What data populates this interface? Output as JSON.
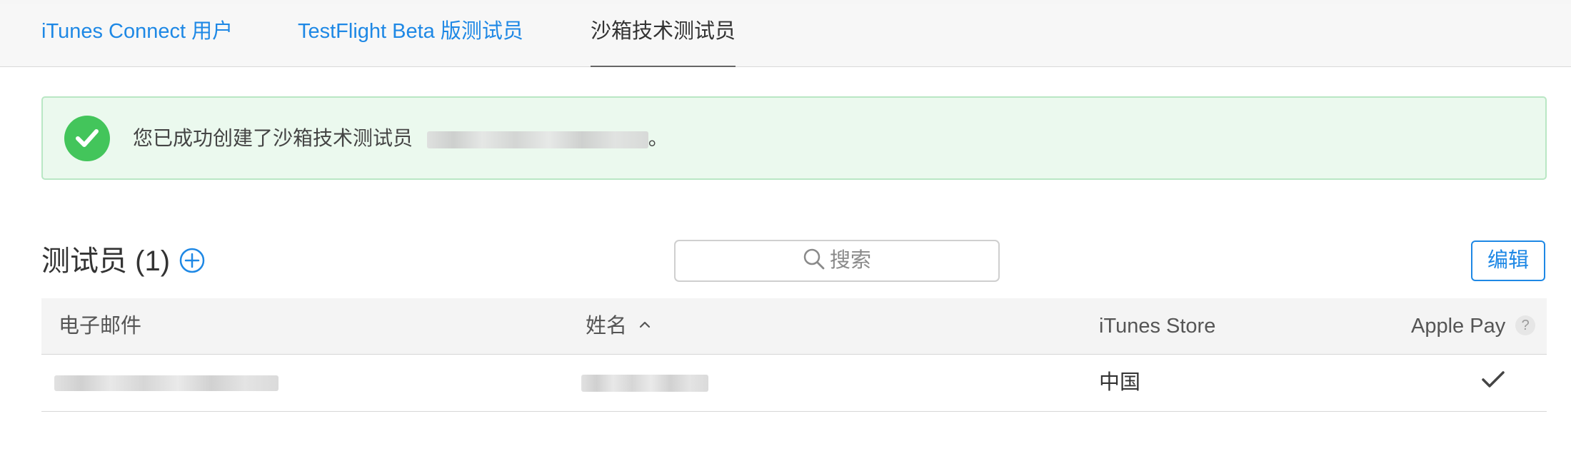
{
  "tabs": [
    {
      "label": "iTunes Connect 用户",
      "active": false
    },
    {
      "label": "TestFlight Beta 版测试员",
      "active": false
    },
    {
      "label": "沙箱技术测试员",
      "active": true
    }
  ],
  "alert": {
    "message": "您已成功创建了沙箱技术测试员",
    "suffix": "。",
    "icon": "check-circle-icon",
    "bg_color": "#ebf9ee",
    "icon_color": "#43c55b"
  },
  "testers": {
    "title": "测试员",
    "count": "(1)",
    "add_icon": "plus-circle-icon"
  },
  "search": {
    "placeholder": "搜索",
    "icon": "search-icon"
  },
  "edit_label": "编辑",
  "table": {
    "columns": {
      "email": "电子邮件",
      "name": "姓名",
      "store": "iTunes Store",
      "apple_pay": "Apple Pay"
    },
    "sort_column": "name",
    "sort_direction": "ascending",
    "help_icon": "question-circle-icon",
    "rows": [
      {
        "email": "",
        "name": "",
        "store": "中国",
        "apple_pay": true
      }
    ]
  },
  "colors": {
    "accent": "#1e88e5",
    "success": "#43c55b"
  }
}
